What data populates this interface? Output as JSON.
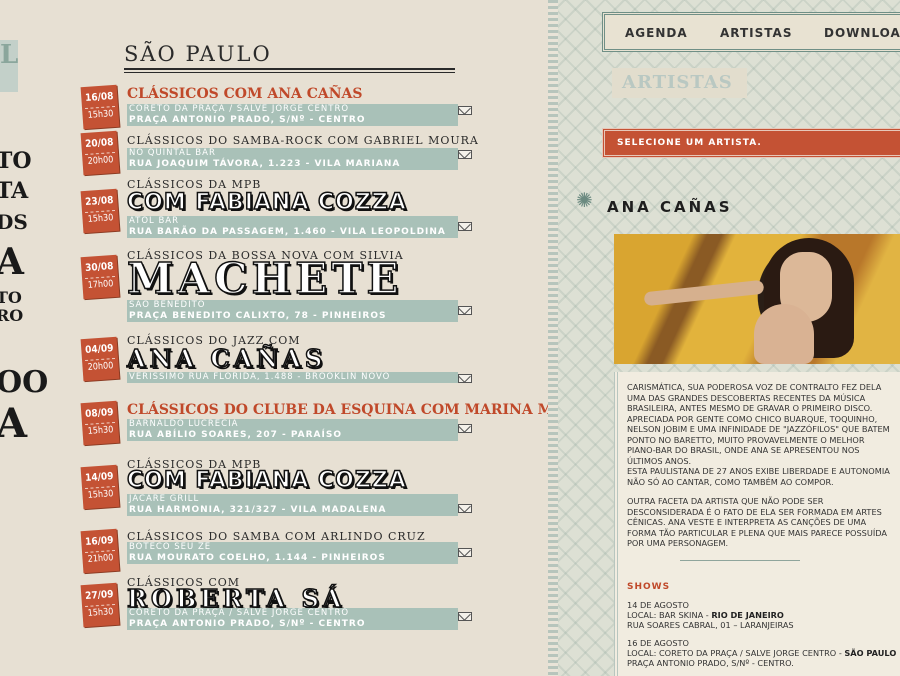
{
  "left": {
    "edge_text": [
      "L",
      "TO",
      "TA",
      "DS",
      "A",
      "TO",
      "RO",
      "OO",
      "A"
    ],
    "city_title": "SÃO PAULO",
    "events": [
      {
        "date": "16/08",
        "time": "15h30",
        "title": "CLÁSSICOS COM ANA CAÑAS",
        "big": "",
        "venue": "CORETO DA PRAÇA / SALVE JORGE CENTRO",
        "address": "PRAÇA ANTONIO PRADO, S/Nº - CENTRO"
      },
      {
        "date": "20/08",
        "time": "20h00",
        "title": "CLÁSSICOS DO SAMBA-ROCK COM GABRIEL MOURA",
        "big": "",
        "venue": "NO QUINTAL BAR",
        "address": "RUA JOAQUIM TÁVORA, 1.223 - VILA MARIANA"
      },
      {
        "date": "23/08",
        "time": "15h30",
        "title": "CLÁSSICOS DA MPB",
        "big": "COM FABIANA COZZA",
        "venue": "ATOL BAR",
        "address": "RUA BARÃO DA PASSAGEM, 1.460 - VILA LEOPOLDINA"
      },
      {
        "date": "30/08",
        "time": "17h00",
        "title": "CLÁSSICOS DA BOSSA NOVA COM SILVIA",
        "big": "MACHETE",
        "venue": "SÃO BENEDITO",
        "address": "PRAÇA BENEDITO CALIXTO, 78 - PINHEIROS"
      },
      {
        "date": "04/09",
        "time": "20h00",
        "title": "CLÁSSICOS DO JAZZ COM",
        "big": "ANA CAÑAS",
        "venue": "VERISSIMO  RUA FLÓRIDA, 1.488 - BROOKLIN NOVO",
        "address": ""
      },
      {
        "date": "08/09",
        "time": "15h30",
        "title": "CLÁSSICOS DO CLUBE DA ESQUINA COM MARINA MACHADO",
        "big": "",
        "venue": "BARNALDO LUCRÉCIA",
        "address": "RUA ABÍLIO SOARES, 207 - PARAÍSO"
      },
      {
        "date": "14/09",
        "time": "15h30",
        "title": "CLÁSSICOS DA MPB",
        "big": "COM FABIANA COZZA",
        "venue": "JACARÉ GRILL",
        "address": "RUA HARMONIA, 321/327 - VILA MADALENA"
      },
      {
        "date": "16/09",
        "time": "21h00",
        "title": "CLÁSSICOS DO SAMBA COM ARLINDO CRUZ",
        "big": "",
        "venue": "BOTECO SEU ZÉ",
        "address": "RUA MOURATO COELHO, 1.144 - PINHEIROS"
      },
      {
        "date": "27/09",
        "time": "15h30",
        "title": "CLÁSSICOS COM",
        "big": "ROBERTA SÁ",
        "venue": "CORETO DA PRAÇA / SALVE JORGE CENTRO",
        "address": "PRAÇA ANTONIO PRADO, S/Nº - CENTRO"
      }
    ]
  },
  "nav": {
    "agenda": "AGENDA",
    "artistas": "ARTISTAS",
    "download": "DOWNLOAD"
  },
  "section_title": "ARTISTAS",
  "select_label": "SELECIONE UM ARTISTA.",
  "artist_name": "ANA CAÑAS",
  "bio": [
    "CARISMÁTICA, SUA PODEROSA VOZ DE CONTRALTO FEZ DELA\nUMA DAS GRANDES DESCOBERTAS RECENTES DA MÚSICA\nBRASILEIRA, ANTES MESMO DE GRAVAR O PRIMEIRO DISCO.\nAPRECIADA POR GENTE COMO CHICO BUARQUE, TOQUINHO,\nNELSON JOBIM E UMA INFINIDADE DE \"JAZZÓFILOS\" QUE BATEM\nPONTO NO BARETTO, MUITO PROVAVELMENTE O MELHOR\nPIANO-BAR DO BRASIL, ONDE ANA SE APRESENTOU NOS\nÚLTIMOS ANOS.",
    "ESTA PAULISTANA DE 27 ANOS EXIBE LIBERDADE E AUTONOMIA\nNÃO SÓ AO CANTAR, COMO TAMBÉM AO COMPOR.",
    "OUTRA FACETA DA ARTISTA QUE NÃO PODE SER\nDESCONSIDERADA É O FATO DE ELA SER FORMADA EM ARTES\nCÊNICAS. ANA VESTE E INTERPRETA AS CANÇÕES DE UMA\nFORMA TÃO PARTICULAR E PLENA QUE MAIS PARECE POSSUÍDA\nPOR UMA PERSONAGEM."
  ],
  "shows_title": "SHOWS",
  "shows": [
    {
      "date": "14 DE AGOSTO",
      "local_prefix": "LOCAL: BAR SKINA - ",
      "local_city": "RIO DE JANEIRO",
      "address": "RUA SOARES CABRAL, 01 – LARANJEIRAS"
    },
    {
      "date": "16 DE AGOSTO",
      "local_prefix": "LOCAL: CORETO DA PRAÇA / SALVE JORGE CENTRO - ",
      "local_city": "SÃO PAULO",
      "address": "PRAÇA ANTONIO PRADO, S/Nº - CENTRO."
    }
  ],
  "colors": {
    "accent_red": "#c45234",
    "sage": "#a9c1b8",
    "paper": "#e7e0d3"
  }
}
